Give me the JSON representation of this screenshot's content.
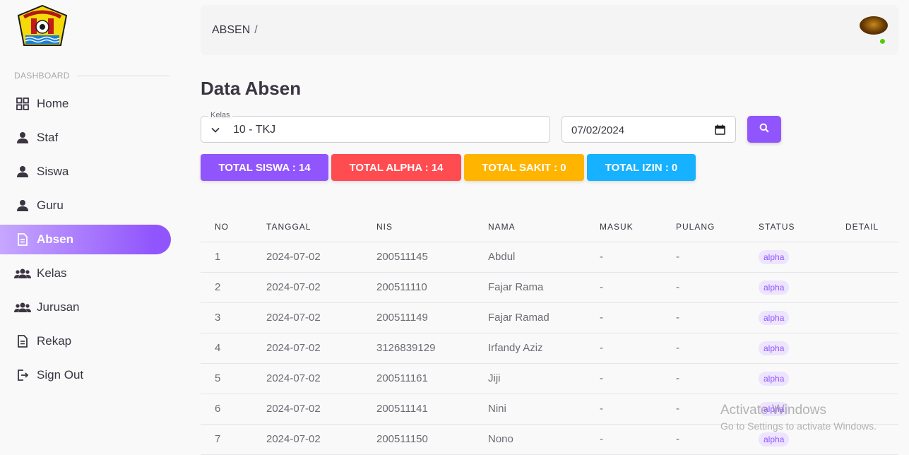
{
  "sidebar": {
    "section_label": "DASHBOARD",
    "items": [
      {
        "label": "Home",
        "icon": "grid-icon"
      },
      {
        "label": "Staf",
        "icon": "person-icon"
      },
      {
        "label": "Siswa",
        "icon": "person-icon"
      },
      {
        "label": "Guru",
        "icon": "person-icon"
      },
      {
        "label": "Absen",
        "icon": "document-icon",
        "active": true
      },
      {
        "label": "Kelas",
        "icon": "group-icon"
      },
      {
        "label": "Jurusan",
        "icon": "group-icon"
      },
      {
        "label": "Rekap",
        "icon": "document-icon"
      },
      {
        "label": "Sign Out",
        "icon": "logout-icon"
      }
    ]
  },
  "topbar": {
    "breadcrumb": "ABSEN",
    "separator": "/"
  },
  "page": {
    "title": "Data Absen"
  },
  "filters": {
    "kelas_label": "Kelas",
    "kelas_value": "10 - TKJ",
    "date_value": "07/02/2024"
  },
  "stats": [
    {
      "label": "TOTAL SISWA : 14",
      "color": "#9155fd"
    },
    {
      "label": "TOTAL ALPHA : 14",
      "color": "#ff4c51"
    },
    {
      "label": "TOTAL SAKIT : 0",
      "color": "#ffb400"
    },
    {
      "label": "TOTAL IZIN : 0",
      "color": "#16b1ff"
    }
  ],
  "table": {
    "headers": [
      "NO",
      "TANGGAL",
      "NIS",
      "NAMA",
      "MASUK",
      "PULANG",
      "STATUS",
      "DETAIL"
    ],
    "rows": [
      {
        "no": "1",
        "tanggal": "2024-07-02",
        "nis": "200511145",
        "nama": "Abdul",
        "masuk": "-",
        "pulang": "-",
        "status": "alpha"
      },
      {
        "no": "2",
        "tanggal": "2024-07-02",
        "nis": "200511110",
        "nama": "Fajar Rama",
        "masuk": "-",
        "pulang": "-",
        "status": "alpha"
      },
      {
        "no": "3",
        "tanggal": "2024-07-02",
        "nis": "200511149",
        "nama": "Fajar Ramad",
        "masuk": "-",
        "pulang": "-",
        "status": "alpha"
      },
      {
        "no": "4",
        "tanggal": "2024-07-02",
        "nis": "3126839129",
        "nama": "Irfandy Aziz",
        "masuk": "-",
        "pulang": "-",
        "status": "alpha"
      },
      {
        "no": "5",
        "tanggal": "2024-07-02",
        "nis": "200511161",
        "nama": "Jiji",
        "masuk": "-",
        "pulang": "-",
        "status": "alpha"
      },
      {
        "no": "6",
        "tanggal": "2024-07-02",
        "nis": "200511141",
        "nama": "Nini",
        "masuk": "-",
        "pulang": "-",
        "status": "alpha"
      },
      {
        "no": "7",
        "tanggal": "2024-07-02",
        "nis": "200511150",
        "nama": "Nono",
        "masuk": "-",
        "pulang": "-",
        "status": "alpha"
      }
    ]
  },
  "watermark": {
    "line1": "Activate Windows",
    "line2": "Go to Settings to activate Windows."
  }
}
